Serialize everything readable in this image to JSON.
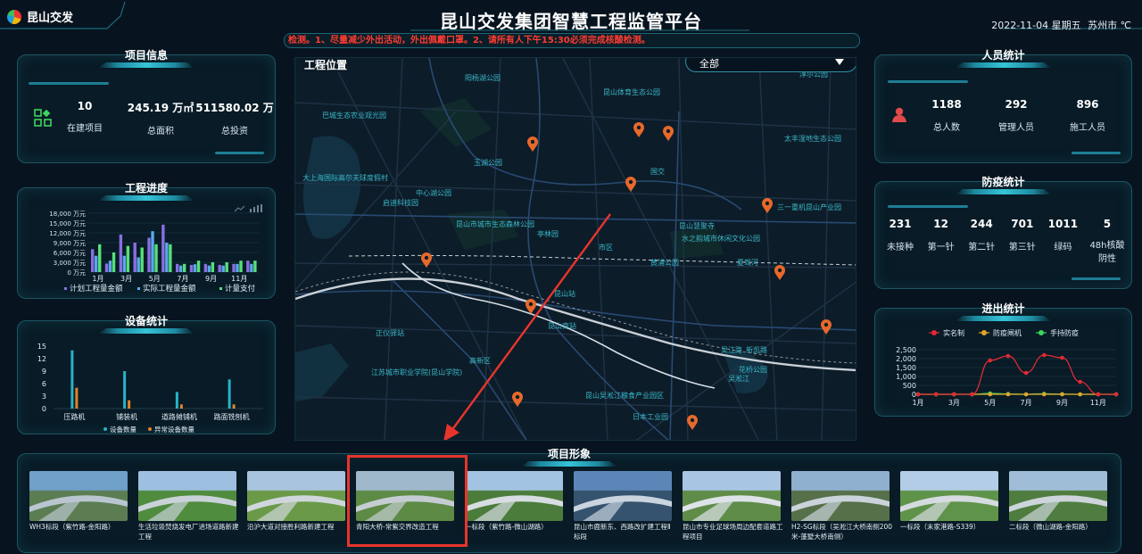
{
  "header": {
    "logo": "昆山交发",
    "title": "昆山交发集团智慧工程监管平台",
    "datetime": "2022-11-04 星期五",
    "weather": "苏州市 ℃",
    "notice": "检测。1、尽量减少外出活动，外出佩戴口罩。2、请所有人下午15:30必须完成核酸检测。"
  },
  "project_info": {
    "title": "项目信息",
    "items": [
      {
        "value": "10",
        "label": "在建项目"
      },
      {
        "value": "245.19 万㎡",
        "label": "总面积"
      },
      {
        "value": "511580.02 万",
        "label": "总投资"
      }
    ]
  },
  "progress": {
    "title": "工程进度",
    "y_ticks": [
      "18,000 万元",
      "15,000 万元",
      "12,000 万元",
      "9,000 万元",
      "6,000 万元",
      "3,000 万元",
      "0 万元"
    ],
    "x_ticks": [
      "1月",
      "3月",
      "5月",
      "7月",
      "9月",
      "11月"
    ],
    "legend": [
      "计划工程量金额",
      "实际工程量金额",
      "计量支付"
    ],
    "colors": [
      "#8a6fe0",
      "#5aa8e8",
      "#56e07a"
    ]
  },
  "devices": {
    "title": "设备统计",
    "legend": [
      "设备数量",
      "异常设备数量"
    ],
    "colors": [
      "#27b3c9",
      "#e0822c"
    ]
  },
  "map": {
    "title": "工程位置",
    "select_value": "全部",
    "labels": [
      "阳杨湖公园",
      "昆山体育生态公园",
      "淳尔公园",
      "巴城生态农业观光园",
      "玉湖公园",
      "太丰湿地生态公园",
      "大上海国际高尔夫球度假村",
      "中心湖公园",
      "启迪科技园",
      "国交",
      "三一重机昆山产业园",
      "昆山市城市生态森林公园",
      "亭林园",
      "昆山慧聚寺",
      "水之韵城市休闲文化公园",
      "黄浦公园",
      "市区",
      "正仪驿站",
      "昆山站",
      "昆山南站",
      "江苏城市职业学院(昆山学院)",
      "高新区",
      "昆山吴淞江粮食产业园区",
      "吴江路",
      "日本工业园",
      "新凯路",
      "花桥公园",
      "吴淞江",
      "夏驾河"
    ]
  },
  "personnel": {
    "title": "人员统计",
    "items": [
      {
        "value": "1188",
        "label": "总人数"
      },
      {
        "value": "292",
        "label": "管理人员"
      },
      {
        "value": "896",
        "label": "施工人员"
      }
    ]
  },
  "epidemic": {
    "title": "防疫统计",
    "items": [
      {
        "value": "231",
        "label": "未接种"
      },
      {
        "value": "12",
        "label": "第一针"
      },
      {
        "value": "244",
        "label": "第二针"
      },
      {
        "value": "701",
        "label": "第三针"
      },
      {
        "value": "1011",
        "label": "绿码"
      },
      {
        "value": "5",
        "label": "48h核酸阴性"
      }
    ]
  },
  "access": {
    "title": "进出统计",
    "legend": [
      "实名制",
      "防疫闸机",
      "手持防疫"
    ],
    "colors": [
      "#e02a34",
      "#e0a52a",
      "#3fd45e"
    ],
    "y_ticks": [
      "2,500",
      "2,000",
      "1,500",
      "1,000",
      "500",
      "0"
    ],
    "x_ticks": [
      "1月",
      "3月",
      "5月",
      "7月",
      "9月",
      "11月"
    ]
  },
  "gallery": {
    "title": "项目形象",
    "items": [
      "WH3标段（紫竹路-金阳路）",
      "生活垃圾焚烧发电厂进场道路新建工程",
      "沿沪大道对接胜利路新建工程",
      "青阳大桥-常紫交界改造工程",
      "一标段（紫竹路-微山湖路）",
      "昆山市鹿新东、西路改扩建工程Ⅱ标段",
      "昆山市专业足球场周边配套道路工程项目",
      "H2-SG标段（吴淞江大桥南侧200米-蓬墅大桥南侧）",
      "一标段（末家港路-S339）",
      "二标段（微山湖路-金阳路）"
    ]
  },
  "chart_data": [
    {
      "type": "bar",
      "title": "工程进度",
      "categories": [
        "1月",
        "2月",
        "3月",
        "4月",
        "5月",
        "6月",
        "7月",
        "8月",
        "9月",
        "10月",
        "11月",
        "12月"
      ],
      "ylim": [
        0,
        18000
      ],
      "series": [
        {
          "name": "计划工程量金额",
          "values": [
            7000,
            2600,
            11500,
            9000,
            10500,
            14500,
            2500,
            2200,
            2500,
            2200,
            2500,
            3500
          ]
        },
        {
          "name": "实际工程量金额",
          "values": [
            5000,
            3500,
            5000,
            4500,
            12500,
            9000,
            2000,
            2400,
            2000,
            2000,
            2500,
            2500
          ]
        },
        {
          "name": "计量支付",
          "values": [
            8500,
            6000,
            8000,
            7500,
            8500,
            8500,
            2500,
            3500,
            3000,
            3000,
            3500,
            3500
          ]
        }
      ]
    },
    {
      "type": "bar",
      "title": "设备统计",
      "categories": [
        "压路机",
        "铺装机",
        "道路摊铺机",
        "路面铣刨机"
      ],
      "ylim": [
        0,
        15
      ],
      "series": [
        {
          "name": "设备数量",
          "values": [
            14,
            9,
            4,
            7
          ]
        },
        {
          "name": "异常设备数量",
          "values": [
            5,
            2,
            1,
            1
          ]
        }
      ]
    },
    {
      "type": "line",
      "title": "进出统计",
      "categories": [
        "1月",
        "2月",
        "3月",
        "4月",
        "5月",
        "6月",
        "7月",
        "8月",
        "9月",
        "10月",
        "11月",
        "12月"
      ],
      "ylim": [
        0,
        2500
      ],
      "series": [
        {
          "name": "实名制",
          "values": [
            0,
            0,
            0,
            0,
            1900,
            2150,
            1200,
            2200,
            2050,
            700,
            0,
            0
          ]
        },
        {
          "name": "防疫闸机",
          "values": [
            0,
            0,
            0,
            0,
            0,
            0,
            0,
            0,
            0,
            0,
            0,
            0
          ]
        },
        {
          "name": "手持防疫",
          "values": [
            0,
            0,
            0,
            0,
            50,
            20,
            0,
            30,
            10,
            0,
            0,
            0
          ]
        }
      ]
    }
  ]
}
